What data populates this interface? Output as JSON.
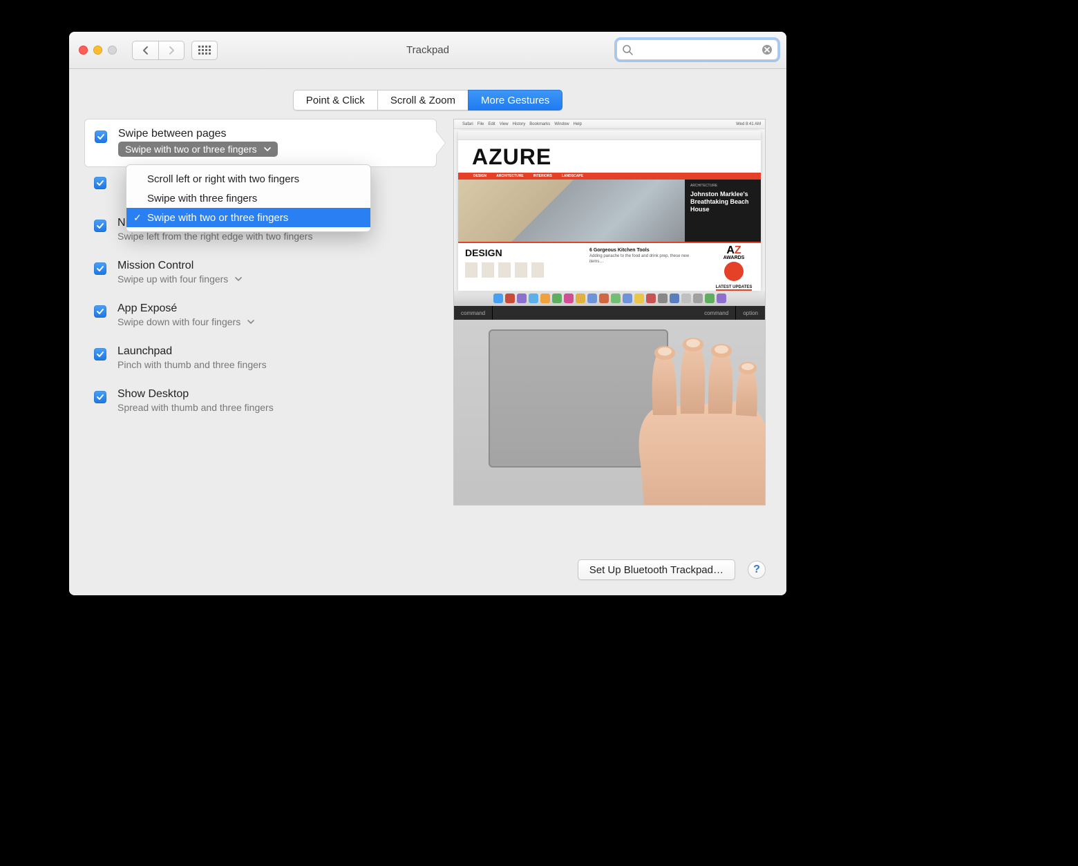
{
  "window": {
    "title": "Trackpad"
  },
  "search": {
    "placeholder": ""
  },
  "tabs": [
    {
      "label": "Point & Click",
      "active": false
    },
    {
      "label": "Scroll & Zoom",
      "active": false
    },
    {
      "label": "More Gestures",
      "active": true
    }
  ],
  "gestures": [
    {
      "title": "Swipe between pages",
      "subtitle": "Swipe with two or three fingers",
      "checked": true,
      "has_dropdown": true,
      "dropdown_open": true,
      "highlighted": true
    },
    {
      "title": "",
      "subtitle": "",
      "checked": true,
      "has_dropdown": false
    },
    {
      "title": "Notification Center",
      "subtitle": "Swipe left from the right edge with two fingers",
      "checked": true,
      "has_dropdown": false
    },
    {
      "title": "Mission Control",
      "subtitle": "Swipe up with four fingers",
      "checked": true,
      "has_dropdown": true
    },
    {
      "title": "App Exposé",
      "subtitle": "Swipe down with four fingers",
      "checked": true,
      "has_dropdown": true
    },
    {
      "title": "Launchpad",
      "subtitle": "Pinch with thumb and three fingers",
      "checked": true,
      "has_dropdown": false
    },
    {
      "title": "Show Desktop",
      "subtitle": "Spread with thumb and three fingers",
      "checked": true,
      "has_dropdown": false
    }
  ],
  "dropdown": {
    "options": [
      "Scroll left or right with two fingers",
      "Swipe with three fingers",
      "Swipe with two or three fingers"
    ],
    "selected_index": 2
  },
  "preview": {
    "menubar_left": [
      "Safari",
      "File",
      "Edit",
      "View",
      "History",
      "Bookmarks",
      "Window",
      "Help"
    ],
    "menubar_right": [
      "Wed 8:41 AM"
    ],
    "site_title": "AZURE",
    "redbar_items": [
      "DESIGN",
      "ARCHITECTURE",
      "INTERIORS",
      "LANDSCAPE"
    ],
    "hero_kicker": "ARCHITECTURE",
    "hero_headline": "Johnston Marklee's Breathtaking Beach House",
    "section_heading": "DESIGN",
    "section_sub": "6 Gorgeous Kitchen Tools",
    "awards_label": "AWARDS",
    "latest_label": "LATEST UPDATES",
    "kb_keys_left": "command",
    "kb_keys_right1": "command",
    "kb_keys_right2": "option"
  },
  "footer": {
    "bluetooth_label": "Set Up Bluetooth Trackpad…",
    "help_label": "?"
  }
}
